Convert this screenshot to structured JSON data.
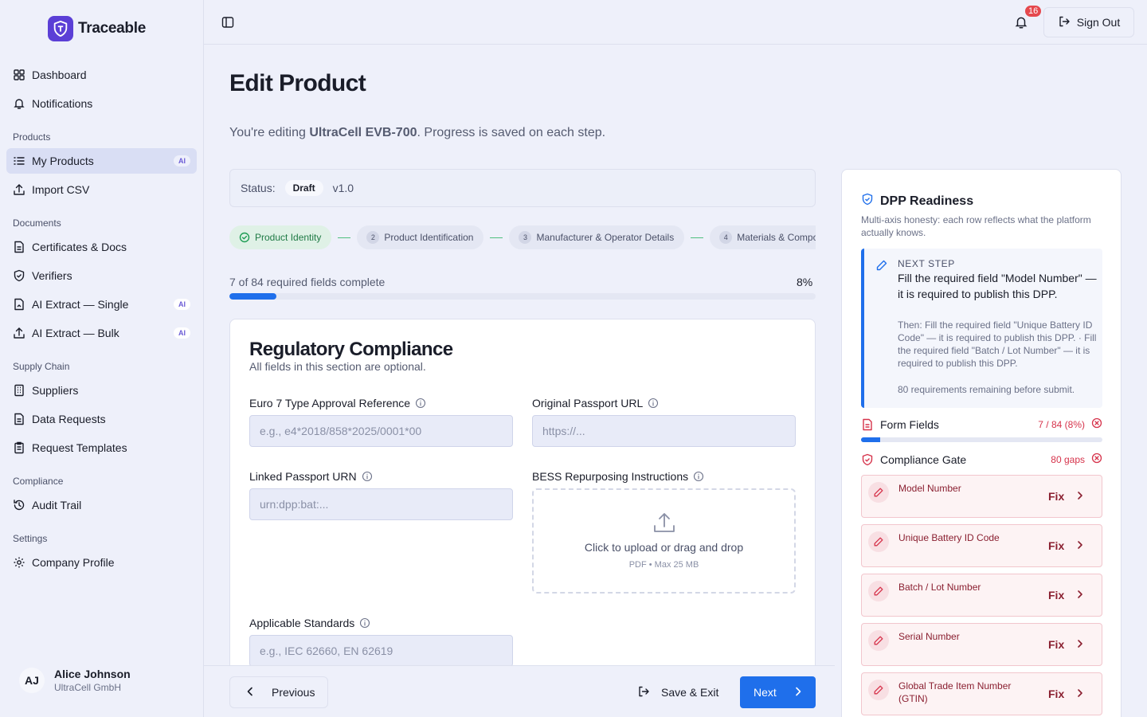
{
  "app": {
    "name": "Traceable"
  },
  "topbar": {
    "notification_count": "16",
    "signout_label": "Sign Out"
  },
  "sidebar": {
    "items_top": [
      {
        "label": "Dashboard",
        "icon": "grid-icon"
      },
      {
        "label": "Notifications",
        "icon": "bell-icon"
      }
    ],
    "sections": [
      {
        "title": "Products",
        "items": [
          {
            "label": "My Products",
            "icon": "list-icon",
            "badge": "AI",
            "active": true
          },
          {
            "label": "Import CSV",
            "icon": "upload-icon"
          }
        ]
      },
      {
        "title": "Documents",
        "items": [
          {
            "label": "Certificates & Docs",
            "icon": "file-icon"
          },
          {
            "label": "Verifiers",
            "icon": "shield-icon"
          },
          {
            "label": "AI Extract — Single",
            "icon": "file-icon",
            "badge": "AI"
          },
          {
            "label": "AI Extract — Bulk",
            "icon": "upload-icon",
            "badge": "AI"
          }
        ]
      },
      {
        "title": "Supply Chain",
        "items": [
          {
            "label": "Suppliers",
            "icon": "building-icon"
          },
          {
            "label": "Data Requests",
            "icon": "file-icon"
          },
          {
            "label": "Request Templates",
            "icon": "clipboard-icon"
          }
        ]
      },
      {
        "title": "Compliance",
        "items": [
          {
            "label": "Audit Trail",
            "icon": "history-icon"
          }
        ]
      },
      {
        "title": "Settings",
        "items": [
          {
            "label": "Company Profile",
            "icon": "gear-icon"
          }
        ]
      }
    ],
    "user": {
      "initials": "AJ",
      "name": "Alice Johnson",
      "org": "UltraCell GmbH"
    }
  },
  "main": {
    "title": "Edit Product",
    "subtitle_prefix": "You're editing ",
    "product_name": "UltraCell EVB-700",
    "subtitle_suffix": ". Progress is saved on each step.",
    "status_label": "Status:",
    "status_value": "Draft",
    "version": "v1.0",
    "steps": [
      {
        "num": "",
        "label": "Product Identity",
        "done": true
      },
      {
        "num": "2",
        "label": "Product Identification"
      },
      {
        "num": "3",
        "label": "Manufacturer & Operator Details"
      },
      {
        "num": "4",
        "label": "Materials & Composition"
      }
    ],
    "progress_text": "7 of 84 required fields complete",
    "progress_pct_label": "8%",
    "progress_value": 0.08
  },
  "section": {
    "title": "Regulatory Compliance",
    "subtitle": "All fields in this section are optional.",
    "fields": {
      "euro7": {
        "label": "Euro 7 Type Approval Reference",
        "placeholder": "e.g., e4*2018/858*2025/0001*00"
      },
      "passport_url": {
        "label": "Original Passport URL",
        "placeholder": "https://..."
      },
      "linked_urn": {
        "label": "Linked Passport URN",
        "placeholder": "urn:dpp:bat:..."
      },
      "bess": {
        "label": "BESS Repurposing Instructions",
        "upload_text": "Click to upload or drag and drop",
        "upload_hint": "PDF • Max 25 MB"
      },
      "standards": {
        "label": "Applicable Standards",
        "placeholder": "e.g., IEC 62660, EN 62619"
      }
    }
  },
  "footer": {
    "previous": "Previous",
    "save_exit": "Save & Exit",
    "next": "Next"
  },
  "readiness": {
    "title": "DPP Readiness",
    "description": "Multi-axis honesty: each row reflects what the platform actually knows.",
    "next_step": {
      "kicker": "NEXT STEP",
      "main": "Fill the required field \"Model Number\" — it is required to publish this DPP.",
      "then": "Then: Fill the required field \"Unique Battery ID Code\" — it is required to publish this DPP. · Fill the required field \"Batch / Lot Number\" — it is required to publish this DPP.",
      "remaining": "80 requirements remaining before submit."
    },
    "form_fields": {
      "label": "Form Fields",
      "value": "7 / 84 (8%)",
      "progress": 0.08
    },
    "compliance_gate": {
      "label": "Compliance Gate",
      "value": "80 gaps"
    },
    "gaps": [
      {
        "label": "Model Number",
        "action": "Fix"
      },
      {
        "label": "Unique Battery ID Code",
        "action": "Fix"
      },
      {
        "label": "Batch / Lot Number",
        "action": "Fix"
      },
      {
        "label": "Serial Number",
        "action": "Fix"
      },
      {
        "label": "Global Trade Item Number (GTIN)",
        "action": "Fix"
      }
    ]
  },
  "colors": {
    "accent": "#1f6feb",
    "brand": "#5b3fd6",
    "danger": "#d6334b",
    "success": "#1f7a45"
  }
}
